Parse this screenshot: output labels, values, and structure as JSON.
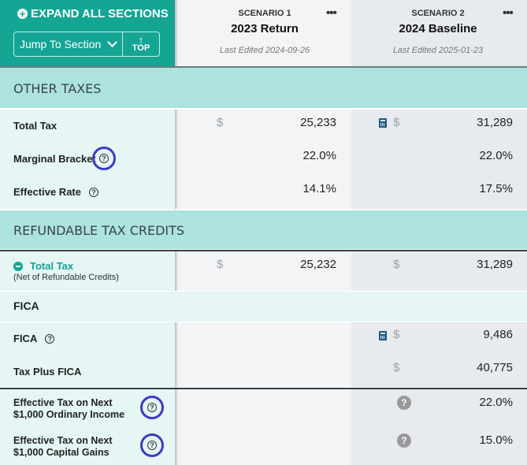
{
  "header": {
    "expand_all_label": "EXPAND ALL SECTIONS",
    "jump_to_section_label": "Jump To Section",
    "top_label": "TOP",
    "scenarios": [
      {
        "label": "SCENARIO 1",
        "title": "2023 Return",
        "last_edited": "Last Edited 2024-09-26"
      },
      {
        "label": "SCENARIO 2",
        "title": "2024 Baseline",
        "last_edited": "Last Edited 2025-01-23"
      }
    ],
    "more_icon": "•••"
  },
  "sections": {
    "other_taxes": {
      "title": "OTHER TAXES",
      "rows": [
        {
          "label": "Total Tax",
          "s1_currency": "$",
          "s1": "25,233",
          "s2_currency": "$",
          "s2": "31,289"
        },
        {
          "label": "Marginal Bracket",
          "s1": "22.0%",
          "s2": "22.0%"
        },
        {
          "label": "Effective Rate",
          "s1": "14.1%",
          "s2": "17.5%"
        }
      ]
    },
    "refundable": {
      "title": "REFUNDABLE TAX CREDITS",
      "total_tax": {
        "label": "Total Tax",
        "sublabel": "(Net of Refundable Credits)",
        "s1_currency": "$",
        "s1": "25,232",
        "s2_currency": "$",
        "s2": "31,289"
      },
      "fica_heading": "FICA",
      "fica": {
        "label": "FICA",
        "s2_currency": "$",
        "s2": "9,486"
      },
      "tax_plus_fica": {
        "label": "Tax Plus FICA",
        "s2_currency": "$",
        "s2": "40,775"
      },
      "eff_ordinary": {
        "line1": "Effective Tax on Next",
        "line2": "$1,000 Ordinary Income",
        "s2": "22.0%"
      },
      "eff_capgains": {
        "line1": "Effective Tax on Next",
        "line2": "$1,000 Capital Gains",
        "s2": "15.0%"
      }
    }
  },
  "icons": {
    "help": "?",
    "plus": "+",
    "up_arrow": "↑"
  },
  "colors": {
    "brand": "#14a594",
    "banner": "#ade3de",
    "highlight_ring": "#3b3bc4"
  }
}
